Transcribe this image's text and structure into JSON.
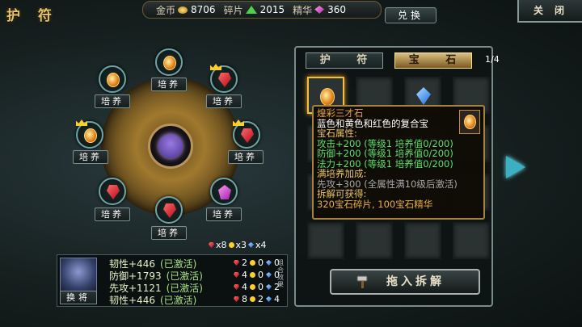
{
  "title": "护 符",
  "currency": {
    "gold": {
      "label": "金币",
      "value": "8706"
    },
    "shards": {
      "label": "碎片",
      "value": "2015"
    },
    "essence": {
      "label": "精华",
      "value": "360"
    }
  },
  "exchange_label": "兑换",
  "close_label": "关闭",
  "wheel": {
    "slot_label": "培养",
    "slots": [
      {
        "name": "top",
        "gem": "gold"
      },
      {
        "name": "top-left",
        "gem": "gold"
      },
      {
        "name": "top-right",
        "gem": "red"
      },
      {
        "name": "left",
        "gem": "gold"
      },
      {
        "name": "right",
        "gem": "red"
      },
      {
        "name": "bottom-left",
        "gem": "red"
      },
      {
        "name": "bottom-right",
        "gem": "purple"
      },
      {
        "name": "bottom",
        "gem": "red"
      }
    ]
  },
  "gem_counts": {
    "red": "x8",
    "yellow": "x3",
    "blue": "x4"
  },
  "stats": {
    "swap_label": "换将",
    "lines": [
      {
        "text": "韧性+446",
        "state": "(已激活)"
      },
      {
        "text": "防御+1793",
        "state": "(已激活)"
      },
      {
        "text": "先攻+1121",
        "state": "(已激活)"
      },
      {
        "text": "韧性+446",
        "state": "(已激活)"
      }
    ],
    "counts": [
      [
        "2",
        "0",
        "0"
      ],
      [
        "4",
        "0",
        "0"
      ],
      [
        "4",
        "0",
        "2"
      ],
      [
        "8",
        "2",
        "4"
      ]
    ],
    "combo_label": "组合效果"
  },
  "tabs": {
    "amulet": "护 符",
    "gem": "宝 石"
  },
  "page_indicator": "1/4",
  "disassemble_label": "拖入拆解",
  "tooltip": {
    "name": "煌彩三才石",
    "desc": "蓝色和黄色和红色的复合宝",
    "attr_head": "宝石属性:",
    "attrs": [
      "攻击+200 (等级1 培养值0/200)",
      "防御+200 (等级1 培养值0/200)",
      "法力+200 (等级1 培养值0/200)"
    ],
    "bonus_head": "满培养加成:",
    "bonus": "先攻+300 (全属性满10级后激活)",
    "yield_head": "拆解可获得:",
    "yield": "320宝石碎片, 100宝石精华"
  },
  "colors": {
    "accent_gold": "#e8c468",
    "panel_border": "#7a8a88",
    "active_green": "#5ee06a"
  },
  "icons": {
    "hammer": "hammer-icon",
    "next": "arrow-right-icon"
  }
}
